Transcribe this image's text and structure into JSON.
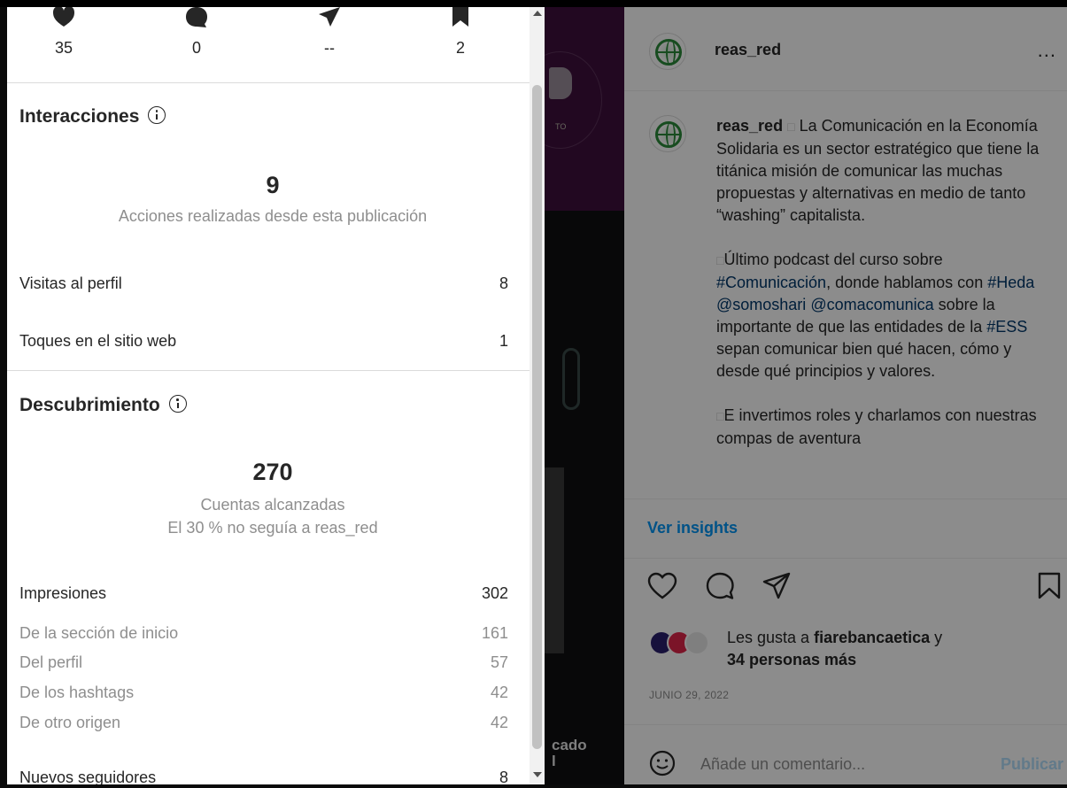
{
  "panel": {
    "top_stats": [
      {
        "icon": "heart-icon",
        "value": "35"
      },
      {
        "icon": "comment-icon",
        "value": "0"
      },
      {
        "icon": "share-icon",
        "value": "--"
      },
      {
        "icon": "bookmark-icon",
        "value": "2"
      }
    ],
    "interactions": {
      "title": "Interacciones",
      "total": "9",
      "subtitle": "Acciones realizadas desde esta publicación",
      "rows": [
        {
          "label": "Visitas al perfil",
          "value": "8"
        },
        {
          "label": "Toques en el sitio web",
          "value": "1"
        }
      ]
    },
    "discovery": {
      "title": "Descubrimiento",
      "total": "270",
      "subtitle": "Cuentas alcanzadas",
      "subtitle2": "El 30 % no seguía a reas_red",
      "impressions": {
        "label": "Impresiones",
        "value": "302"
      },
      "sources": [
        {
          "label": "De la sección de inicio",
          "value": "161"
        },
        {
          "label": "Del perfil",
          "value": "57"
        },
        {
          "label": "De los hashtags",
          "value": "42"
        },
        {
          "label": "De otro origen",
          "value": "42"
        }
      ],
      "new_followers": {
        "label": "Nuevos seguidores",
        "value": "8"
      }
    }
  },
  "image": {
    "caption_fragment": "cado\nl"
  },
  "post": {
    "username": "reas_red",
    "more": "...",
    "caption": {
      "username": "reas_red",
      "para1": "La Comunicación en la Economía Solidaria es un sector estratégico que tiene la titánica misión de comunicar las muchas propuestas y alternativas en medio de tanto “washing” capitalista.",
      "para2_a": "Último podcast del curso sobre ",
      "para2_tag1": "#Comunicación",
      "para2_b": ", donde hablamos con ",
      "para2_tag2": "#Heda",
      "para2_c": " ",
      "para2_tag3": "@somoshari",
      "para2_d": " ",
      "para2_tag4": "@comacomunica",
      "para2_e": " sobre la importante de que las entidades de la ",
      "para2_tag5": "#ESS",
      "para2_f": " sepan comunicar bien qué hacen, cómo y desde qué principios y valores.",
      "para3": "E invertimos roles y charlamos con nuestras compas de aventura"
    },
    "ver_insights": "Ver insights",
    "likes_prefix": "Les gusta a ",
    "likes_user": "fiarebancaetica",
    "likes_mid": " y",
    "likes_others": "34 personas más",
    "date": "JUNIO 29, 2022",
    "comment_placeholder": "Añade un comentario...",
    "publish": "Publicar"
  },
  "colors": {
    "accent_link": "#0095f6",
    "hashtag": "#00376b",
    "muted": "#8e8e8e"
  }
}
